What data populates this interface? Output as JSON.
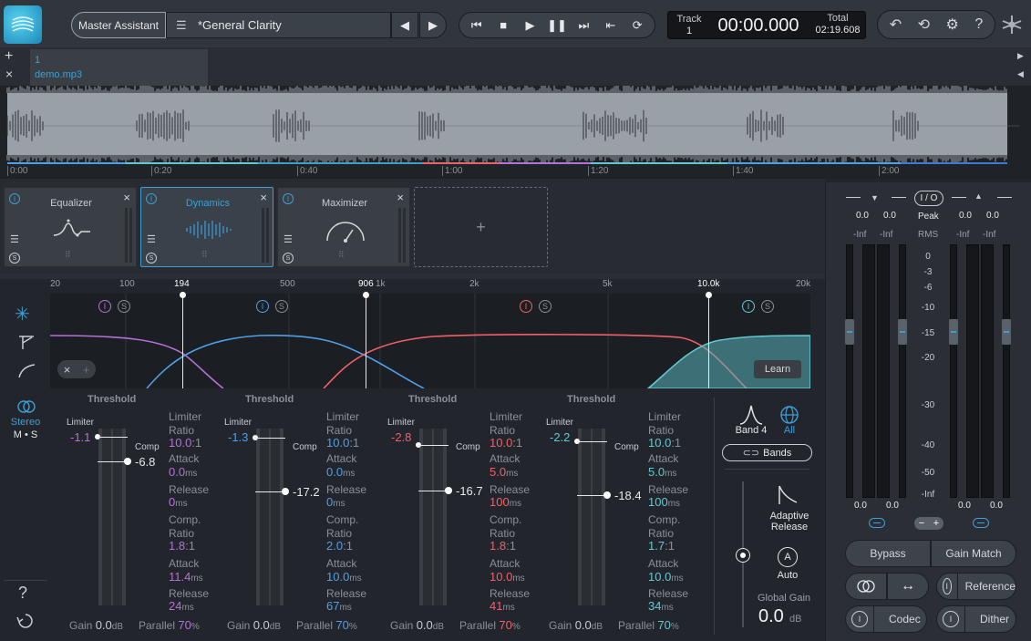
{
  "header": {
    "master_assistant": "Master Assistant",
    "preset_name": "*General Clarity",
    "track_label": "Track",
    "track_number": "1",
    "time": "00:00.000",
    "total_label": "Total",
    "total_time": "02:19.608"
  },
  "tabs": {
    "add": "+",
    "close": "×",
    "tab_number": "1",
    "tab_file": "demo.mp3"
  },
  "timeline": [
    "0:00",
    "0:20",
    "0:40",
    "1:00",
    "1:20",
    "1:40",
    "2:00"
  ],
  "modules": [
    {
      "name": "Equalizer",
      "selected": false
    },
    {
      "name": "Dynamics",
      "selected": true
    },
    {
      "name": "Maximizer",
      "selected": false
    }
  ],
  "add_module": "+",
  "freq_labels": [
    "20",
    "100",
    "194",
    "500",
    "906",
    "1k",
    "2k",
    "5k",
    "10.0k",
    "20k"
  ],
  "learn": "Learn",
  "stereo": {
    "label": "Stereo",
    "ms": "M • S"
  },
  "bands": [
    {
      "threshold": "Threshold",
      "limiter_label": "Limiter",
      "limiter_val": "-1.1",
      "comp_label": "Comp",
      "comp_val": "-6.8",
      "lim_ratio": "10.0",
      "lim_attack": "0.0",
      "lim_release": "0",
      "comp_ratio": "1.8",
      "comp_attack": "11.4",
      "comp_release": "24",
      "gain": "0.0",
      "parallel": "70",
      "color": "#b472d6"
    },
    {
      "threshold": "Threshold",
      "limiter_label": "Limiter",
      "limiter_val": "-1.3",
      "comp_label": "Comp",
      "comp_val": "-17.2",
      "lim_ratio": "10.0",
      "lim_attack": "0.0",
      "lim_release": "0",
      "comp_ratio": "2.0",
      "comp_attack": "10.0",
      "comp_release": "67",
      "gain": "0.0",
      "parallel": "70",
      "color": "#4f9fe6"
    },
    {
      "threshold": "Threshold",
      "limiter_label": "Limiter",
      "limiter_val": "-2.8",
      "comp_label": "Comp",
      "comp_val": "-16.7",
      "lim_ratio": "10.0",
      "lim_attack": "5.0",
      "lim_release": "100",
      "comp_ratio": "1.8",
      "comp_attack": "10.0",
      "comp_release": "41",
      "gain": "0.0",
      "parallel": "70",
      "color": "#f0606a"
    },
    {
      "threshold": "Threshold",
      "limiter_label": "Limiter",
      "limiter_val": "-2.2",
      "comp_label": "Comp",
      "comp_val": "-18.4",
      "lim_ratio": "10.0",
      "lim_attack": "5.0",
      "lim_release": "100",
      "comp_ratio": "1.7",
      "comp_attack": "10.0",
      "comp_release": "34",
      "gain": "0.0",
      "parallel": "70",
      "color": "#62c8d0"
    }
  ],
  "labels": {
    "limiter": "Limiter",
    "ratio": "Ratio",
    "attack": "Attack",
    "release": "Release",
    "comp": "Comp.",
    "ms": "ms",
    "ratio_suffix": ":1",
    "gain": "Gain",
    "db": "dB",
    "parallel": "Parallel",
    "pct": "%"
  },
  "band_sel": {
    "band": "Band 4",
    "all": "All",
    "bands_btn": "Bands"
  },
  "adaptive": "Adaptive Release",
  "auto": "Auto",
  "auto_letter": "A",
  "global_gain_label": "Global Gain",
  "global_gain": "0.0",
  "global_gain_unit": "dB",
  "meters": {
    "io": "I / O",
    "peak": "Peak",
    "rms": "RMS",
    "in_vals": [
      "0.0",
      "0.0"
    ],
    "out_vals": [
      "0.0",
      "0.0"
    ],
    "in_inf": [
      "-Inf",
      "-Inf"
    ],
    "out_inf": [
      "-Inf",
      "-Inf"
    ],
    "scale": [
      "0",
      "-3",
      "-6",
      "-10",
      "-15",
      "-20",
      "-30",
      "-40",
      "-50",
      "-Inf"
    ],
    "bottom_in": [
      "0.0",
      "0.0"
    ],
    "bottom_out": [
      "0.0",
      "0.0"
    ]
  },
  "right_buttons": {
    "bypass": "Bypass",
    "gain_match": "Gain Match",
    "reference": "Reference",
    "codec": "Codec",
    "dither": "Dither"
  },
  "help": "?",
  "colors": {
    "accent": "#3d9fd6",
    "purple": "#b472d6",
    "blue": "#4f9fe6",
    "red": "#f0606a",
    "teal": "#62c8d0"
  }
}
